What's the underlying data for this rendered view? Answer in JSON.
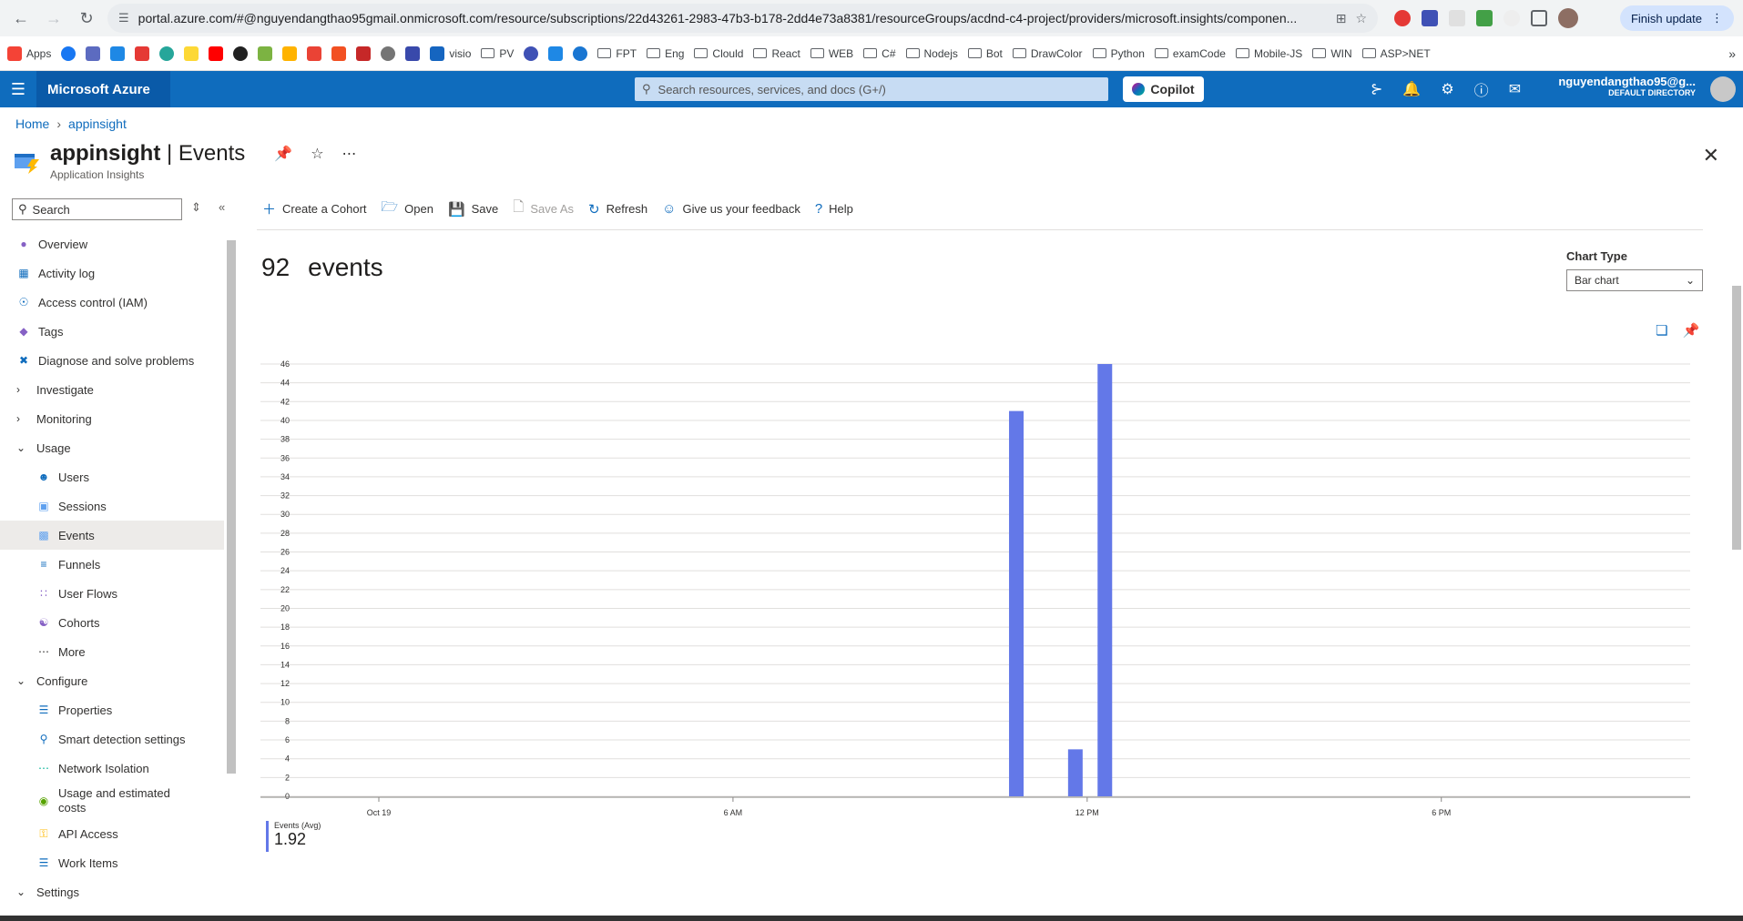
{
  "browser": {
    "url": "portal.azure.com/#@nguyendangthao95gmail.onmicrosoft.com/resource/subscriptions/22d43261-2983-47b3-b178-2dd4e73a8381/resourceGroups/acdnd-c4-project/providers/microsoft.insights/componen...",
    "update_label": "Finish update",
    "bookmarks": [
      "Apps",
      "visio",
      "PV",
      "FPT",
      "Eng",
      "Clould",
      "React",
      "WEB",
      "C#",
      "Nodejs",
      "Bot",
      "DrawColor",
      "Python",
      "examCode",
      "Mobile-JS",
      "WIN",
      "ASP>NET"
    ]
  },
  "azure": {
    "brand": "Microsoft Azure",
    "search_placeholder": "Search resources, services, and docs (G+/)",
    "copilot_label": "Copilot",
    "account_name": "nguyendangthao95@g...",
    "account_directory": "DEFAULT DIRECTORY"
  },
  "breadcrumb": {
    "home": "Home",
    "current": "appinsight"
  },
  "header": {
    "resource_name": "appinsight",
    "separator": " | ",
    "page_name": "Events",
    "subtitle": "Application Insights"
  },
  "sidebar": {
    "search_placeholder": "Search",
    "items": [
      {
        "label": "Overview"
      },
      {
        "label": "Activity log"
      },
      {
        "label": "Access control (IAM)"
      },
      {
        "label": "Tags"
      },
      {
        "label": "Diagnose and solve problems"
      },
      {
        "label": "Investigate"
      },
      {
        "label": "Monitoring"
      },
      {
        "label": "Usage"
      },
      {
        "label": "Users"
      },
      {
        "label": "Sessions"
      },
      {
        "label": "Events"
      },
      {
        "label": "Funnels"
      },
      {
        "label": "User Flows"
      },
      {
        "label": "Cohorts"
      },
      {
        "label": "More"
      },
      {
        "label": "Configure"
      },
      {
        "label": "Properties"
      },
      {
        "label": "Smart detection settings"
      },
      {
        "label": "Network Isolation"
      },
      {
        "label": "Usage and estimated costs"
      },
      {
        "label": "API Access"
      },
      {
        "label": "Work Items"
      },
      {
        "label": "Settings"
      }
    ]
  },
  "toolbar": {
    "create_cohort": "Create a Cohort",
    "open": "Open",
    "save": "Save",
    "save_as": "Save As",
    "refresh": "Refresh",
    "feedback": "Give us your feedback",
    "help": "Help"
  },
  "summary": {
    "count": "92",
    "unit": "events"
  },
  "chart_type": {
    "label": "Chart Type",
    "selected": "Bar chart"
  },
  "legend": {
    "label": "Events (Avg)",
    "value": "1.92"
  },
  "colors": {
    "accent": "#0f6cbd",
    "bar": "#6378e8"
  },
  "chart_data": {
    "type": "bar",
    "xlabel": "",
    "ylabel": "",
    "ylim": [
      0,
      46
    ],
    "yticks": [
      0,
      2,
      4,
      6,
      8,
      10,
      12,
      14,
      16,
      18,
      20,
      22,
      24,
      26,
      28,
      30,
      32,
      34,
      36,
      38,
      40,
      42,
      44,
      46
    ],
    "x_ticks": [
      {
        "label": "Oct 19",
        "hour": 0
      },
      {
        "label": "6 AM",
        "hour": 6
      },
      {
        "label": "12 PM",
        "hour": 12
      },
      {
        "label": "6 PM",
        "hour": 18
      }
    ],
    "x_range_hours": [
      0,
      22
    ],
    "series": [
      {
        "name": "Events (Avg)",
        "points": [
          {
            "hour": 10.8,
            "value": 41
          },
          {
            "hour": 11.8,
            "value": 5
          },
          {
            "hour": 12.3,
            "value": 46
          }
        ]
      }
    ]
  }
}
